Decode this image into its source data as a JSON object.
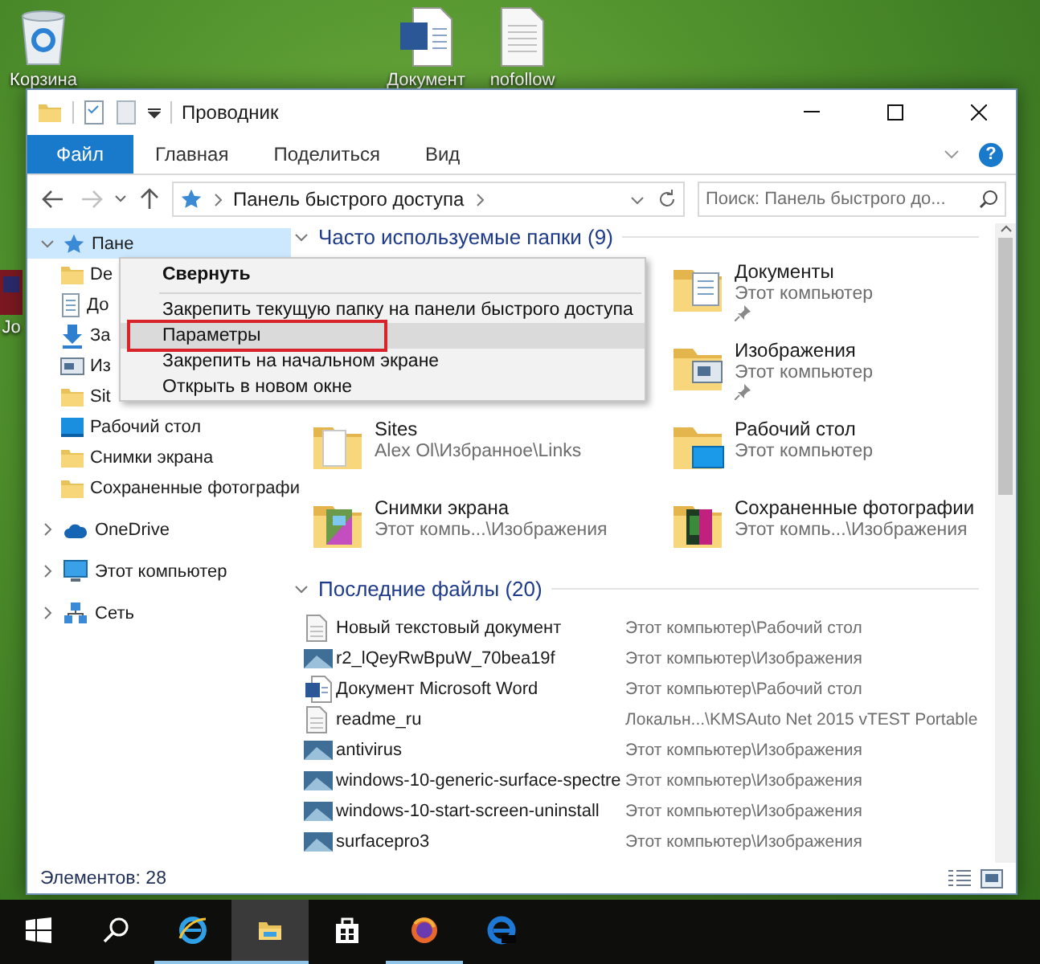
{
  "desktop_icons": [
    {
      "label": "Корзина",
      "kind": "recycle"
    },
    {
      "label": "Документ",
      "kind": "word"
    },
    {
      "label": "nofollow",
      "kind": "text"
    },
    {
      "label": "Jo",
      "kind": "image"
    }
  ],
  "window": {
    "title": "Проводник"
  },
  "ribbon_tabs": [
    {
      "label": "Файл",
      "kind": "file"
    },
    {
      "label": "Главная",
      "kind": "tab"
    },
    {
      "label": "Поделиться",
      "kind": "tab"
    },
    {
      "label": "Вид",
      "kind": "tab"
    }
  ],
  "help": "?",
  "address": {
    "path": "Панель быстрого доступа"
  },
  "search": {
    "placeholder": "Поиск: Панель быстрого до..."
  },
  "navigation": [
    {
      "label": "Пане",
      "kind": "star",
      "expanded": true,
      "selected": true,
      "children": [
        {
          "label": "De",
          "kind": "folder"
        },
        {
          "label": "До",
          "kind": "document"
        },
        {
          "label": "За",
          "kind": "download"
        },
        {
          "label": "Из",
          "kind": "picture"
        },
        {
          "label": "Sit",
          "kind": "folder"
        },
        {
          "label": "Рабочий стол",
          "kind": "desktop"
        },
        {
          "label": "Снимки экрана",
          "kind": "folder"
        },
        {
          "label": "Сохраненные фотографи",
          "kind": "folder"
        }
      ]
    },
    {
      "label": "OneDrive",
      "kind": "cloud",
      "expanded": false,
      "selected": false
    },
    {
      "label": "Этот компьютер",
      "kind": "computer",
      "expanded": false,
      "selected": false
    },
    {
      "label": "Сеть",
      "kind": "network",
      "expanded": false,
      "selected": false
    }
  ],
  "frequent_folders": {
    "title": "Часто используемые папки (9)",
    "expanded": true,
    "items": [
      {
        "name": "Документы",
        "location": "Этот компьютер",
        "pinned": true,
        "kind": "documents"
      },
      {
        "name": "Изображения",
        "location": "Этот компьютер",
        "pinned": true,
        "kind": "pictures"
      },
      {
        "name": "Sites",
        "location": "Alex Ol\\Избранное\\Links",
        "pinned": false,
        "kind": "plain"
      },
      {
        "name": "Рабочий стол",
        "location": "Этот компьютер",
        "pinned": false,
        "kind": "desktop"
      },
      {
        "name": "Снимки экрана",
        "location": "Этот компь...\\Изображения",
        "pinned": false,
        "kind": "screenshots"
      },
      {
        "name": "Сохраненные фотографии",
        "location": "Этот компь...\\Изображения",
        "pinned": false,
        "kind": "photos"
      }
    ]
  },
  "recent_files": {
    "title": "Последние файлы (20)",
    "expanded": true,
    "files": [
      {
        "name": "Новый текстовый документ",
        "location": "Этот компьютер\\Рабочий стол",
        "kind": "text"
      },
      {
        "name": "r2_lQeyRwBpuW_70bea19f",
        "location": "Этот компьютер\\Изображения",
        "kind": "image"
      },
      {
        "name": "Документ Microsoft Word",
        "location": "Этот компьютер\\Рабочий стол",
        "kind": "word"
      },
      {
        "name": "readme_ru",
        "location": "Локальн...\\KMSAuto Net 2015 vTEST Portable",
        "kind": "text"
      },
      {
        "name": "antivirus",
        "location": "Этот компьютер\\Изображения",
        "kind": "image"
      },
      {
        "name": "windows-10-generic-surface-spectre",
        "location": "Этот компьютер\\Изображения",
        "kind": "image"
      },
      {
        "name": "windows-10-start-screen-uninstall",
        "location": "Этот компьютер\\Изображения",
        "kind": "image"
      },
      {
        "name": "surfacepro3",
        "location": "Этот компьютер\\Изображения",
        "kind": "image"
      }
    ]
  },
  "context_menu": [
    {
      "label": "Свернуть",
      "kind": "header",
      "highlighted": false
    },
    {
      "kind": "separator"
    },
    {
      "label": "Закрепить текущую папку на панели быстрого доступа",
      "kind": "item",
      "highlighted": false
    },
    {
      "label": "Параметры",
      "kind": "item",
      "highlighted": true
    },
    {
      "label": "Закрепить на начальном экране",
      "kind": "item",
      "highlighted": false
    },
    {
      "label": "Открыть в новом окне",
      "kind": "item",
      "highlighted": false
    }
  ],
  "status_bar": {
    "item_count": "Элементов: 28"
  },
  "taskbar": [
    {
      "kind": "start",
      "running": false,
      "selected": false
    },
    {
      "kind": "search",
      "running": false,
      "selected": false
    },
    {
      "kind": "ie",
      "running": true,
      "selected": false
    },
    {
      "kind": "explorer",
      "running": true,
      "selected": true
    },
    {
      "kind": "store",
      "running": false,
      "selected": false
    },
    {
      "kind": "firefox",
      "running": true,
      "selected": false
    },
    {
      "kind": "edge",
      "running": false,
      "selected": false
    }
  ]
}
